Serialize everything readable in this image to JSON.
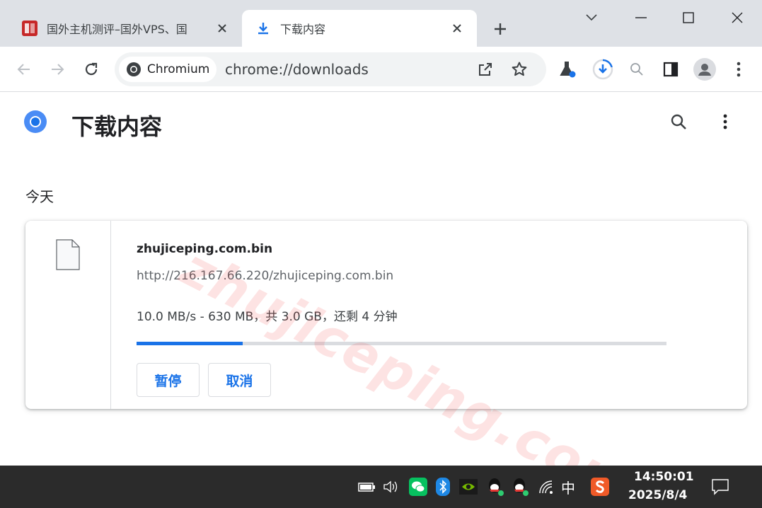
{
  "tabs": [
    {
      "title": "国外主机测评–国外VPS、国",
      "active": false
    },
    {
      "title": "下载内容",
      "active": true
    }
  ],
  "toolbar": {
    "chip_label": "Chromium",
    "url": "chrome://downloads"
  },
  "page": {
    "title": "下载内容",
    "date_heading": "今天"
  },
  "download": {
    "file_name": "zhujiceping.com.bin",
    "source_url": "http://216.167.66.220/zhujiceping.com.bin",
    "status": "10.0 MB/s - 630 MB，共 3.0 GB，还剩 4 分钟",
    "progress_fraction": 0.2,
    "pause_label": "暂停",
    "cancel_label": "取消"
  },
  "watermark": "zhujiceping.com",
  "taskbar": {
    "ime_label": "中",
    "time": "14:50:01",
    "date": "2025/8/4"
  },
  "colors": {
    "accent": "#1a73e8",
    "tabstrip": "#dee1e6",
    "taskbar": "#2b2b2b"
  },
  "icons": [
    "back-icon",
    "forward-icon",
    "reload-icon",
    "share-icon",
    "star-icon",
    "labs-icon",
    "download-progress-icon",
    "zoom-icon",
    "side-panel-icon",
    "profile-icon",
    "menu-icon",
    "search-icon",
    "more-icon",
    "file-icon"
  ]
}
